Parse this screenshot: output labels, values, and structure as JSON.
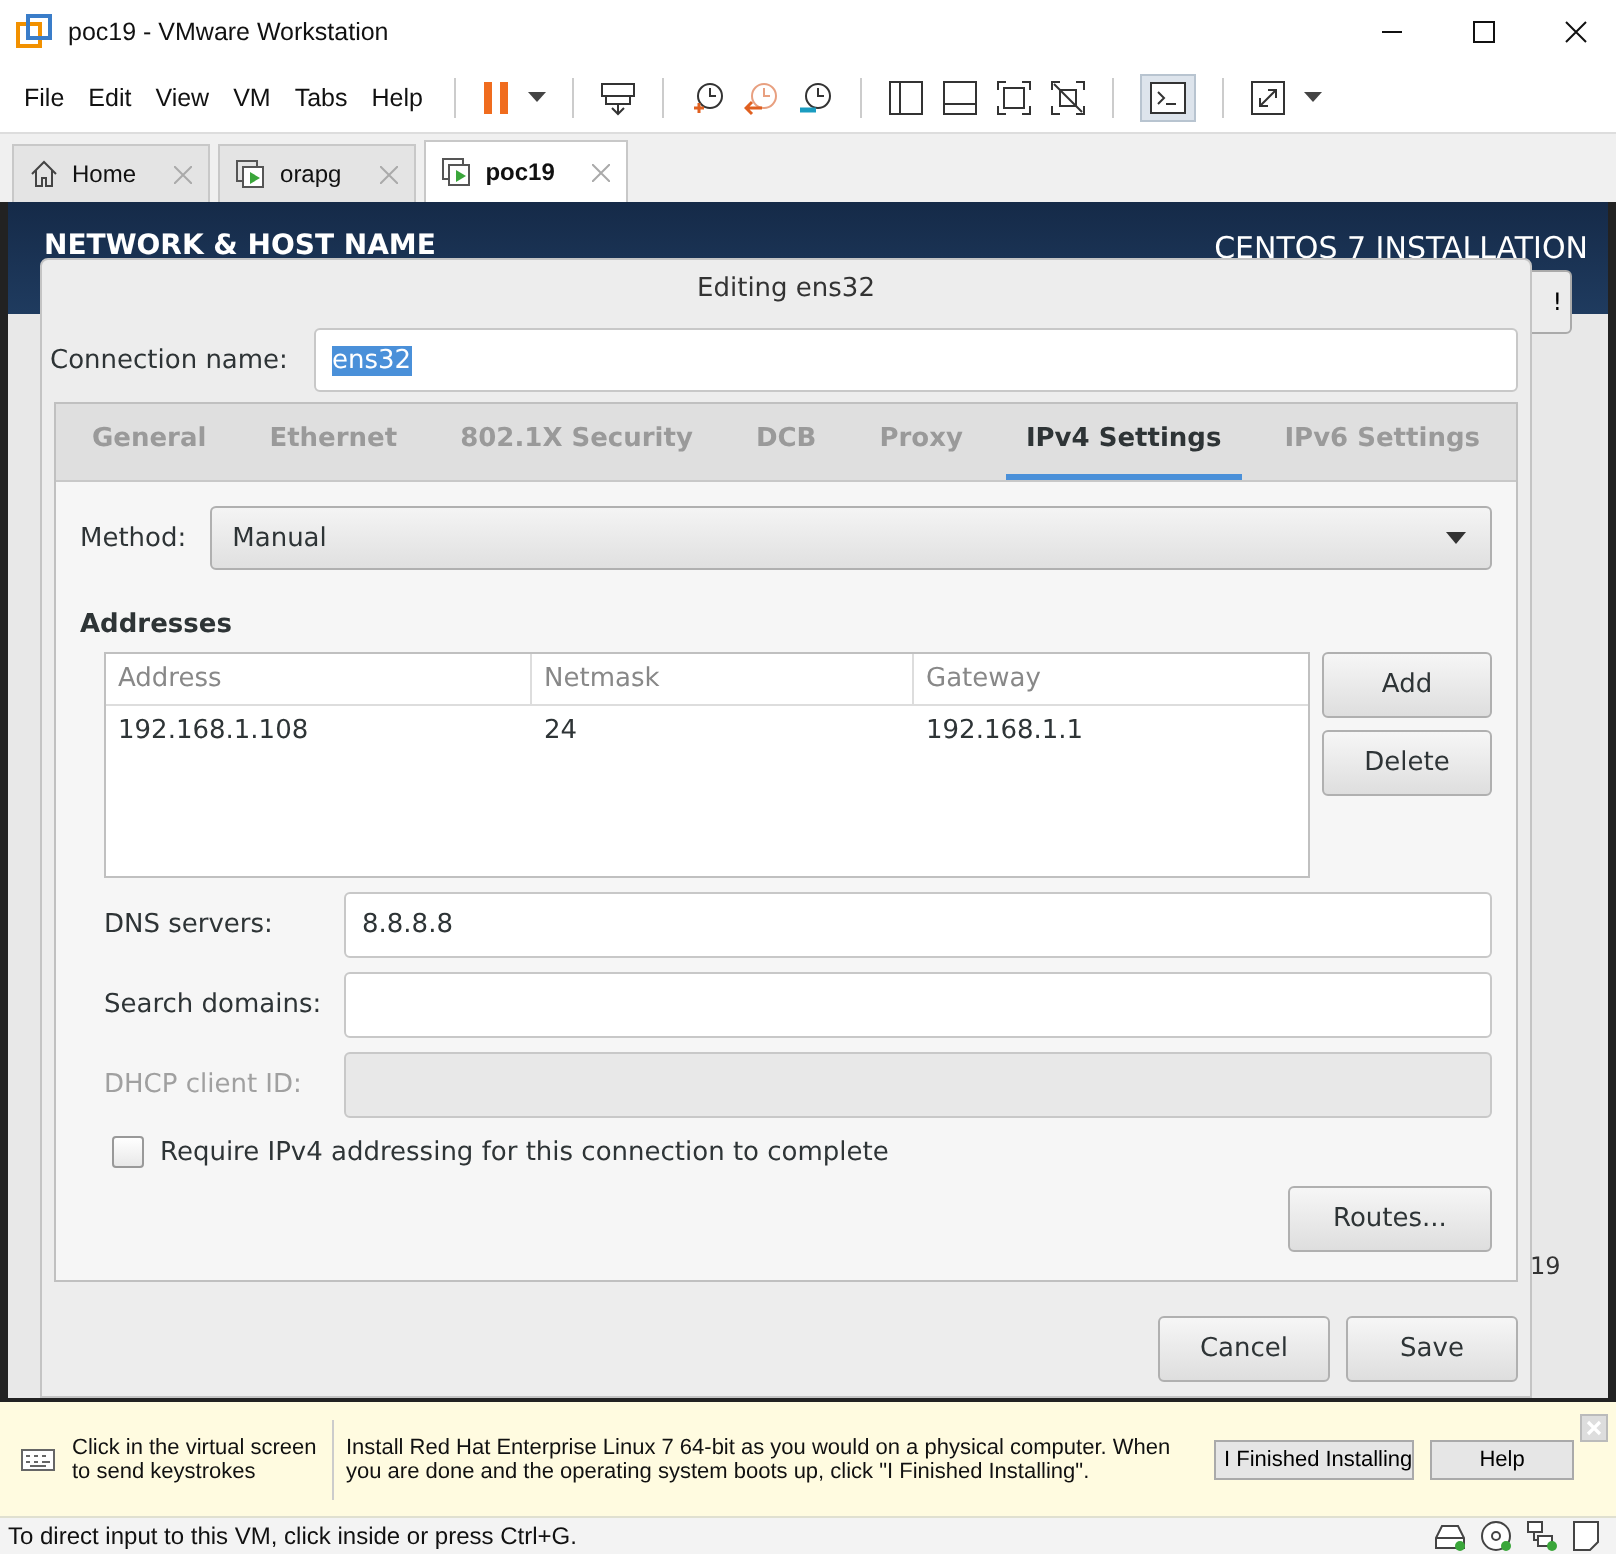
{
  "window": {
    "title": "poc19 - VMware Workstation"
  },
  "menu": [
    "File",
    "Edit",
    "View",
    "VM",
    "Tabs",
    "Help"
  ],
  "tabs": [
    {
      "label": "Home",
      "kind": "home",
      "selected": false
    },
    {
      "label": "orapg",
      "kind": "vm",
      "selected": false
    },
    {
      "label": "poc19",
      "kind": "vm",
      "selected": true
    }
  ],
  "installer": {
    "header_title": "NETWORK & HOST NAME",
    "product_title": "CENTOS 7 INSTALLATION",
    "help_button": "!",
    "side_text": "19"
  },
  "dialog": {
    "title": "Editing ens32",
    "connection_label": "Connection name:",
    "connection_value": "ens32",
    "tabs": [
      {
        "label": "General",
        "selected": false
      },
      {
        "label": "Ethernet",
        "selected": false
      },
      {
        "label": "802.1X Security",
        "selected": false
      },
      {
        "label": "DCB",
        "selected": false
      },
      {
        "label": "Proxy",
        "selected": false
      },
      {
        "label": "IPv4 Settings",
        "selected": true
      },
      {
        "label": "IPv6 Settings",
        "selected": false
      }
    ],
    "method_label": "Method:",
    "method_value": "Manual",
    "addresses_label": "Addresses",
    "columns": [
      "Address",
      "Netmask",
      "Gateway"
    ],
    "rows": [
      [
        "192.168.1.108",
        "24",
        "192.168.1.1"
      ]
    ],
    "address_buttons": [
      "Add",
      "Delete"
    ],
    "fields": [
      {
        "label": "DNS servers:",
        "value": "8.8.8.8",
        "disabled": false
      },
      {
        "label": "Search domains:",
        "disabled": false
      },
      {
        "label": "DHCP client ID:",
        "disabled": true
      }
    ],
    "checkbox": {
      "label": "Require IPv4 addressing for this connection to complete",
      "checked": false
    },
    "routes_button": "Routes...",
    "footer_buttons": [
      "Cancel",
      "Save"
    ]
  },
  "hint_bar": {
    "keys_text": "Click in the virtual screen to send keystrokes",
    "message": "Install Red Hat Enterprise Linux 7 64-bit as you would on a physical computer. When you are done and the operating system boots up, click \"I Finished Installing\".",
    "buttons": [
      "I Finished Installing",
      "Help"
    ]
  },
  "status_bar": {
    "text": "To direct input to this VM, click inside or press Ctrl+G."
  }
}
